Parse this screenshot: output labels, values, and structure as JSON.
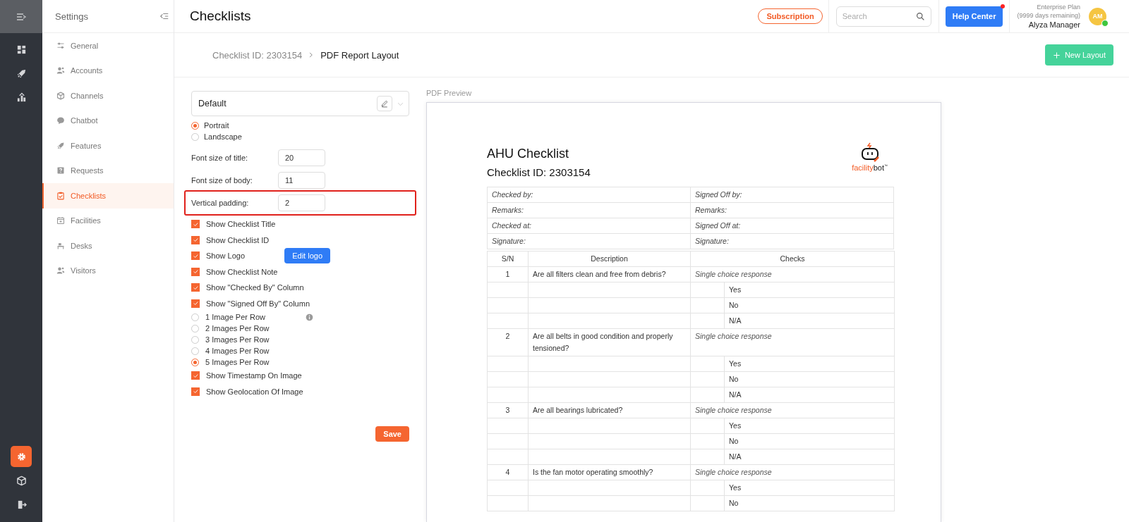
{
  "rail": {
    "main": [
      {
        "kind": "dashboard",
        "selected": false
      },
      {
        "kind": "rocket",
        "selected": false
      },
      {
        "kind": "chart",
        "selected": false
      }
    ],
    "footer": [
      {
        "kind": "settings",
        "selected": true
      },
      {
        "kind": "cube",
        "selected": false
      },
      {
        "kind": "logout",
        "selected": false
      }
    ]
  },
  "settings": {
    "title": "Settings",
    "items": [
      {
        "label": "General",
        "kind": "sliders",
        "selected": false
      },
      {
        "label": "Accounts",
        "kind": "users",
        "selected": false
      },
      {
        "label": "Channels",
        "kind": "cube",
        "selected": false
      },
      {
        "label": "Chatbot",
        "kind": "bubble",
        "selected": false
      },
      {
        "label": "Features",
        "kind": "rocket",
        "selected": false
      },
      {
        "label": "Requests",
        "kind": "question",
        "selected": false
      },
      {
        "label": "Checklists",
        "kind": "clipboard",
        "selected": true
      },
      {
        "label": "Facilities",
        "kind": "calendar",
        "selected": false
      },
      {
        "label": "Desks",
        "kind": "desk",
        "selected": false
      },
      {
        "label": "Visitors",
        "kind": "users",
        "selected": false
      }
    ]
  },
  "header": {
    "title": "Checklists",
    "subscription": "Subscription",
    "search": {
      "placeholder": "Search"
    },
    "help": "Help Center",
    "help_notification": true,
    "plan": "Enterprise Plan",
    "plan_note": "(9999 days remaining)",
    "user": {
      "name": "Alyza Manager",
      "initials": "AM",
      "online": true
    }
  },
  "breadcrumb": {
    "items": [
      "Checklist ID: 2303154",
      "PDF Report Layout"
    ],
    "new_layout": "New Layout"
  },
  "form": {
    "layout": "Default",
    "orientation": [
      {
        "label": "Portrait",
        "selected": true
      },
      {
        "label": "Landscape",
        "selected": false
      }
    ],
    "fields": [
      {
        "label": "Font size of title:",
        "value": "20",
        "highlighted": false
      },
      {
        "label": "Font size of body:",
        "value": "11",
        "highlighted": false
      },
      {
        "label": "Vertical padding:",
        "value": "2",
        "highlighted": true
      }
    ],
    "options": [
      {
        "kind": "checkbox",
        "label": "Show Checklist Title",
        "checked": true
      },
      {
        "kind": "checkbox",
        "label": "Show Checklist ID",
        "checked": true
      },
      {
        "kind": "checkbox",
        "label": "Show Logo",
        "checked": true,
        "action": "Edit logo"
      },
      {
        "kind": "checkbox",
        "label": "Show Checklist Note",
        "checked": true
      },
      {
        "kind": "checkbox",
        "label": "Show \"Checked By\" Column",
        "checked": true
      },
      {
        "kind": "checkbox",
        "label": "Show \"Signed Off By\" Column",
        "checked": true
      },
      {
        "kind": "radio",
        "label": "1 Image Per Row",
        "selected": false,
        "has_info": true
      },
      {
        "kind": "radio",
        "label": "2 Images Per Row",
        "selected": false
      },
      {
        "kind": "radio",
        "label": "3 Images Per Row",
        "selected": false
      },
      {
        "kind": "radio",
        "label": "4 Images Per Row",
        "selected": false
      },
      {
        "kind": "radio",
        "label": "5 Images Per Row",
        "selected": true
      },
      {
        "kind": "checkbox",
        "label": "Show Timestamp On Image",
        "checked": true
      },
      {
        "kind": "checkbox",
        "label": "Show Geolocation Of Image",
        "checked": true
      }
    ],
    "save": "Save"
  },
  "preview": {
    "label": "PDF Preview",
    "title": "AHU Checklist",
    "subtitle": "Checklist ID: 2303154",
    "logo": {
      "part_1": "facility",
      "part_2": "bot",
      "mark": "™"
    },
    "info_rows": [
      [
        "Checked by:",
        "Signed Off by:"
      ],
      [
        "Remarks:",
        "Remarks:"
      ],
      [
        "Checked at:",
        "Signed Off at:"
      ],
      [
        "Signature:",
        "Signature:"
      ]
    ],
    "columns": [
      "S/N",
      "Description",
      "Checks"
    ],
    "items": [
      {
        "sn": "1",
        "description": "Are all filters clean and free from debris?",
        "response": "Single choice response",
        "choices": [
          "Yes",
          "No",
          "N/A"
        ]
      },
      {
        "sn": "2",
        "description": "Are all belts in good condition and properly tensioned?",
        "response": "Single choice response",
        "choices": [
          "Yes",
          "No",
          "N/A"
        ]
      },
      {
        "sn": "3",
        "description": "Are all bearings lubricated?",
        "response": "Single choice response",
        "choices": [
          "Yes",
          "No",
          "N/A"
        ]
      },
      {
        "sn": "4",
        "description": "Is the fan motor operating smoothly?",
        "response": "Single choice response",
        "choices": [
          "Yes",
          "No"
        ]
      }
    ]
  }
}
